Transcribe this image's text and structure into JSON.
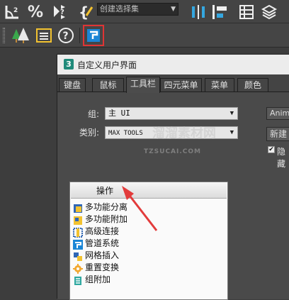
{
  "toolbar": {
    "selection_set_placeholder": "创建选择集"
  },
  "dialog": {
    "title": "自定义用户界面",
    "tabs": [
      "键盘",
      "鼠标",
      "工具栏",
      "四元菜单",
      "菜单",
      "颜色"
    ],
    "active_tab": "工具栏",
    "group_label": "组:",
    "group_value": "主 UI",
    "category_label": "类别:",
    "category_value": "MAX TOOLS",
    "right_combo": "Anime",
    "new_button": "新建",
    "hide_checkbox": "隐藏",
    "list": {
      "header": "操作",
      "items": [
        "多功能分离",
        "多功能附加",
        "高级连接",
        "管道系统",
        "网格插入",
        "重置变换",
        "组附加"
      ]
    }
  },
  "watermark": {
    "main": "溜溜素材网",
    "sub": "TZSUCAI.COM"
  },
  "colors": {
    "highlight_red": "#e03434",
    "tool_blue": "#1b86d6",
    "arrow_red": "#e23b3b"
  }
}
